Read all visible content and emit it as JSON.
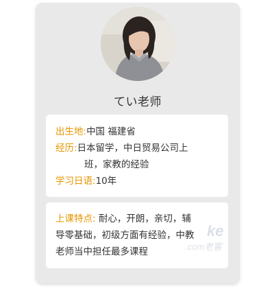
{
  "profile": {
    "name": "てい老师"
  },
  "info": {
    "birthplace_label": "出生地:",
    "birthplace_value": "中国 福建省",
    "experience_label": "经历:",
    "experience_line1": "日本留学，中日贸易公司上",
    "experience_line2": "班，家教的经验",
    "study_years_label": "学习日语:",
    "study_years_value": "10年"
  },
  "features": {
    "label": "上课特点:",
    "text_line1": "耐心，开朗，亲切，辅",
    "text_line2": "导零基础，初级方面有经验，中教",
    "text_line3": "老师当中担任最多课程"
  },
  "watermark": {
    "logo_text": "ke",
    "domain_text": ".com老客"
  },
  "colors": {
    "accent": "#e69600",
    "card_bg": "#e9e9e9",
    "panel_bg": "#ffffff"
  }
}
